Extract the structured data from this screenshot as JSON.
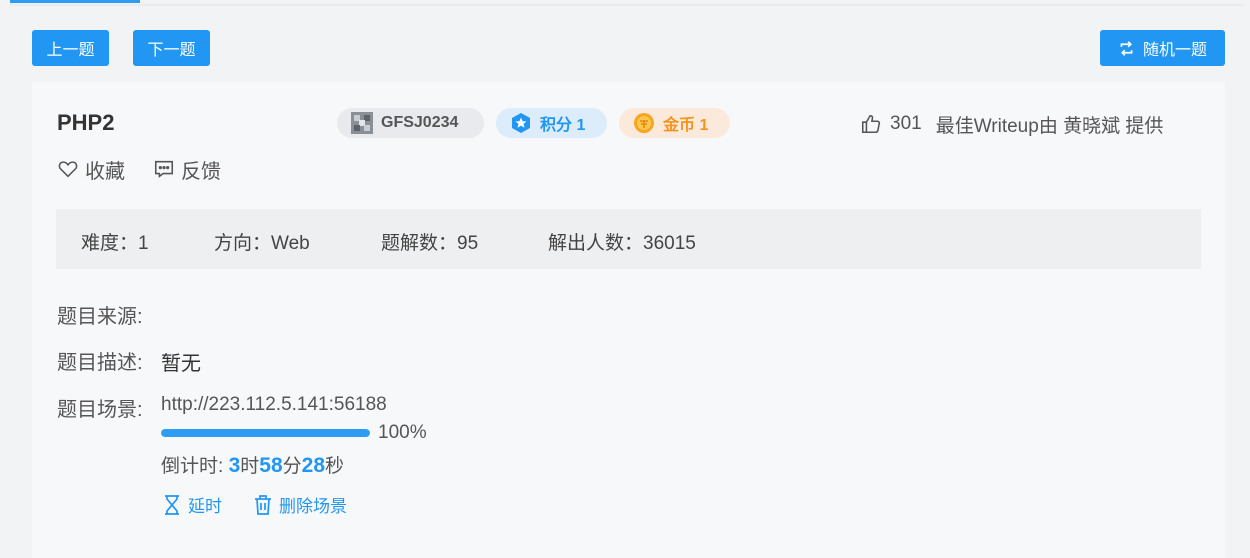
{
  "nav": {
    "prev_label": "上一题",
    "next_label": "下一题",
    "random_label": "随机一题"
  },
  "challenge": {
    "title": "PHP2",
    "id_tag": "GFSJ0234",
    "score_tag": "积分 1",
    "coin_tag": "金币 1",
    "likes": "301",
    "writeup_text": "最佳Writeup由 黄晓斌 提供",
    "favorite_label": "收藏",
    "feedback_label": "反馈"
  },
  "stats": {
    "difficulty": "难度：1",
    "direction": "方向：Web",
    "solves": "题解数：95",
    "solvers": "解出人数：36015"
  },
  "details": {
    "source_label": "题目来源:",
    "desc_label": "题目描述:",
    "desc_value": "暂无",
    "scene_label": "题目场景:",
    "scene_url": "http://223.112.5.141:56188",
    "progress_percent": 100,
    "progress_text": "100%",
    "countdown_prefix": "倒计时: ",
    "countdown_hours": "3",
    "unit_hour": "时",
    "countdown_minutes": "58",
    "unit_min": "分",
    "countdown_seconds": "28",
    "unit_sec": "秒",
    "extend_label": "延时",
    "delete_label": "删除场景"
  },
  "colors": {
    "accent": "#2196f3",
    "coin": "#f5941e"
  },
  "icons": {
    "random": "shuffle-icon",
    "like": "thumbs-up-icon",
    "favorite": "heart-icon",
    "feedback": "chat-icon",
    "extend": "hourglass-icon",
    "delete": "trash-icon",
    "score": "star-icon",
    "coin": "coin-icon",
    "id": "avatar-icon"
  }
}
